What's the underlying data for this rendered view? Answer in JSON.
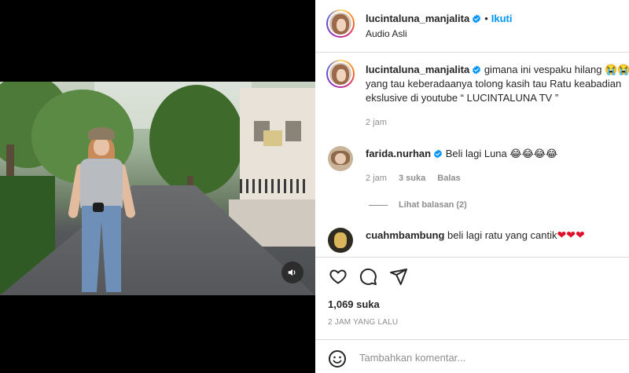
{
  "header": {
    "username": "lucintaluna_manjalita",
    "separator": "•",
    "follow_label": "Ikuti",
    "audio": "Audio Asli"
  },
  "caption": {
    "username": "lucintaluna_manjalita",
    "line1": "gimana ini vespaku hilang 😭😭",
    "line2": "yang tau keberadaanya tolong kasih tau Ratu keabadian",
    "line3": "ekslusive di youtube “ LUCINTALUNA TV ”",
    "time": "2 jam"
  },
  "comments": [
    {
      "username": "farida.nurhan",
      "text": "Beli lagi Luna",
      "emojis": "😂😂😂😂",
      "time": "2 jam",
      "likes": "3 suka",
      "reply_label": "Balas",
      "view_replies": "Lihat balasan (2)"
    },
    {
      "username": "cuahmbambung",
      "text": "beli lagi ratu yang cantik",
      "emojis": "❤❤❤"
    }
  ],
  "actions": {
    "like_icon": "heart-icon",
    "comment_icon": "comment-icon",
    "share_icon": "send-icon"
  },
  "stats": {
    "likes": "1,069 suka",
    "time_ago": "2 JAM YANG LALU"
  },
  "composer": {
    "placeholder": "Tambahkan komentar...",
    "emoji_icon": "smiley-icon"
  },
  "media": {
    "mute_icon": "speaker-icon"
  },
  "colors": {
    "accent": "#0095f6",
    "verified": "#0095f6",
    "heart": "#e0102a",
    "muted_text": "#8e8e8e"
  }
}
